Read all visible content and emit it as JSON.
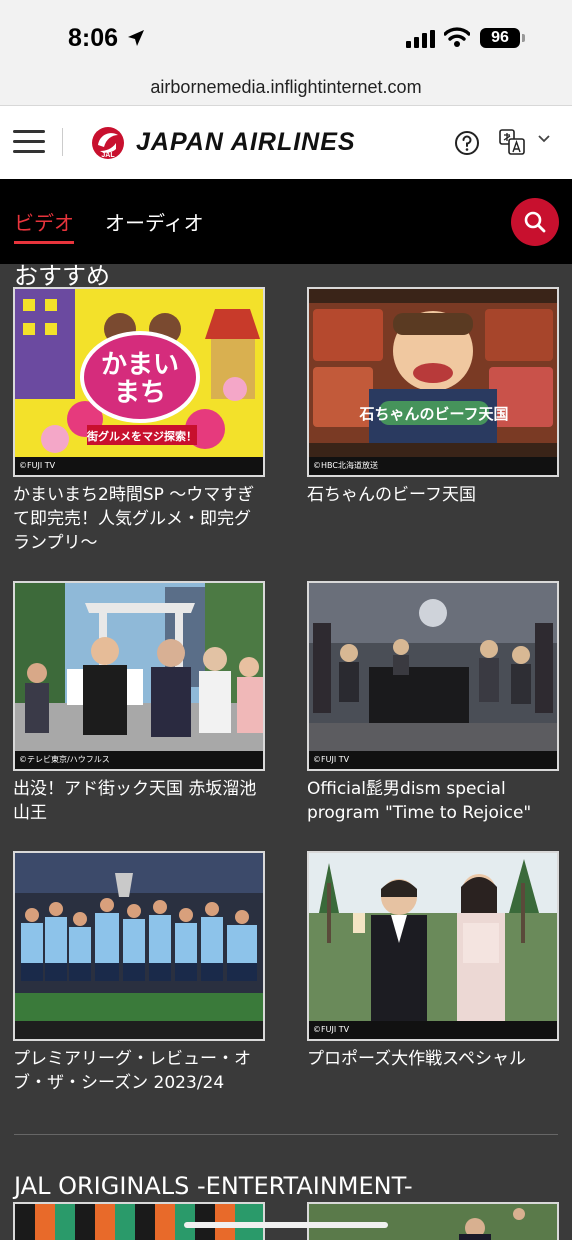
{
  "status_bar": {
    "time": "8:06",
    "battery": "96"
  },
  "url": "airbornemedia.inflightinternet.com",
  "header": {
    "brand": "JAPAN AIRLINES",
    "logo_text": "JAL"
  },
  "nav": {
    "tab_video": "ビデオ",
    "tab_audio": "オーディオ"
  },
  "section_title": "おすすめ",
  "cards": [
    {
      "title": "かまいまち2時間SP 〜ウマすぎて即完売！人気グルメ・即完グランプリ〜",
      "credit": "©FUJI TV"
    },
    {
      "title": "石ちゃんのビーフ天国",
      "credit": "©HBC北海道放送"
    },
    {
      "title": "出没！アド街ック天国 赤坂溜池山王",
      "credit": "©テレビ東京/ハウフルス"
    },
    {
      "title": "Official髭男dism special program \"Time to Rejoice\"",
      "credit": "©FUJI TV"
    },
    {
      "title": "プレミアリーグ・レビュー・オブ・ザ・シーズン 2023/24",
      "credit": ""
    },
    {
      "title": "プロポーズ大作戦スペシャル",
      "credit": "©FUJI TV"
    }
  ],
  "section2_title": "JAL ORIGINALS -ENTERTAINMENT-",
  "colors": {
    "accent": "#e8343c",
    "brand_red": "#c8102e",
    "background": "#3a3a3a"
  },
  "icons": [
    "location-arrow-icon",
    "signal-icon",
    "wifi-icon",
    "battery-icon",
    "hamburger-menu-icon",
    "jal-crane-logo-icon",
    "help-icon",
    "translate-icon",
    "chevron-down-icon",
    "search-icon"
  ]
}
